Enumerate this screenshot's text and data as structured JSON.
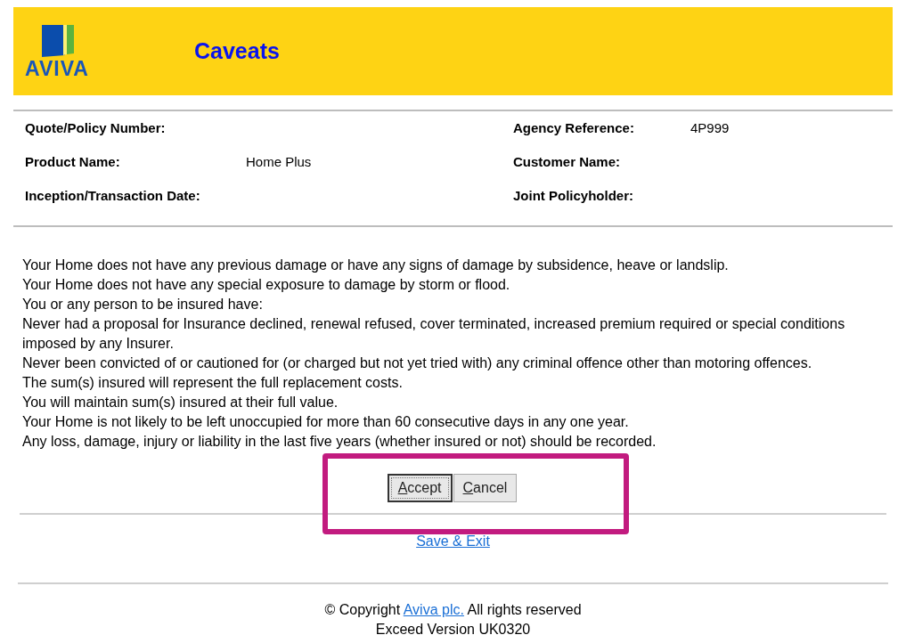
{
  "header": {
    "logo_text": "AVIVA",
    "title": "Caveats"
  },
  "details": {
    "left": [
      {
        "label": "Quote/Policy Number:"
      },
      {
        "label": "Product Name:",
        "value": "Home Plus"
      },
      {
        "label": "Inception/Transaction Date:"
      }
    ],
    "right": [
      {
        "label": "Agency Reference:",
        "value": "4P999"
      },
      {
        "label": "Customer Name:"
      },
      {
        "label": "Joint Policyholder:"
      }
    ]
  },
  "caveats": [
    "Your Home does not have any previous damage or have any signs of damage by subsidence, heave or landslip.",
    "Your Home does not have any special exposure to damage by storm or flood.",
    "You or any person to be insured have:",
    "Never had a proposal for Insurance declined, renewal refused, cover terminated, increased premium required or special conditions imposed by any Insurer.",
    "Never been convicted of or cautioned for (or charged but not yet tried with) any criminal offence other than motoring offences.",
    "The sum(s) insured will represent the full replacement costs.",
    "You will maintain sum(s) insured at their full value.",
    "Your Home is not likely to be left unoccupied for more than 60 consecutive days in any one year.",
    "Any loss, damage, injury or liability in the last five years (whether insured or not) should be recorded."
  ],
  "buttons": [
    {
      "label": "Accept",
      "focused": true
    },
    {
      "label": "Cancel",
      "focused": false
    }
  ],
  "highlight": {
    "shown": true
  },
  "save_link": "Save & Exit",
  "footer": {
    "copyright_before": "© Copyright",
    "company_link": "Aviva plc.",
    "copyright_after": "All rights reserved",
    "version": "Exceed Version UK0320"
  }
}
